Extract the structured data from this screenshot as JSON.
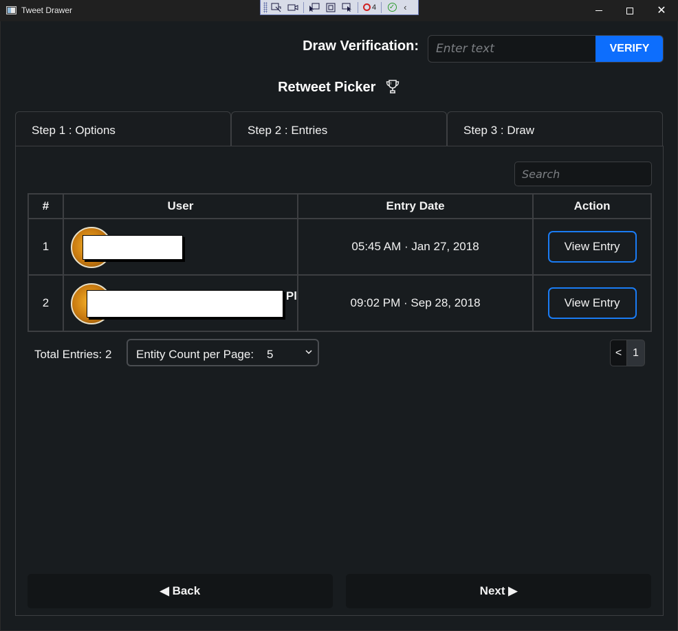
{
  "window": {
    "title": "Tweet Drawer",
    "debug_toolbar": {
      "error_count": "4"
    }
  },
  "verification": {
    "label": "Draw Verification:",
    "input_placeholder": "Enter text",
    "input_value": "",
    "button_label": "VERIFY",
    "accent_color": "#0d6efd"
  },
  "page_title": "Retweet Picker",
  "page_title_icon": "trophy-icon",
  "tabs": [
    {
      "label": "Step 1 : Options"
    },
    {
      "label": "Step 2 : Entries"
    },
    {
      "label": "Step 3 : Draw"
    }
  ],
  "search": {
    "placeholder": "Search",
    "value": ""
  },
  "table": {
    "columns": [
      "#",
      "User",
      "Entry Date",
      "Action"
    ],
    "rows": [
      {
        "num": "1",
        "user": {
          "avatar": "avatar",
          "name_redacted": true,
          "name_fragment": ""
        },
        "entry_date": "05:45 AM · Jan 27, 2018",
        "action": "View Entry"
      },
      {
        "num": "2",
        "user": {
          "avatar": "avatar",
          "name_redacted": true,
          "name_fragment": "Pl"
        },
        "entry_date": "09:02 PM · Sep 28, 2018",
        "action": "View Entry"
      }
    ]
  },
  "footer": {
    "total_entries": "Total Entries: 2",
    "count_per_page_label": "Entity Count per Page:",
    "count_per_page_value": "5",
    "pager_prev": "<",
    "current_page": "1"
  },
  "navigation": {
    "back_label": "◀ Back",
    "next_label": "Next ▶"
  }
}
